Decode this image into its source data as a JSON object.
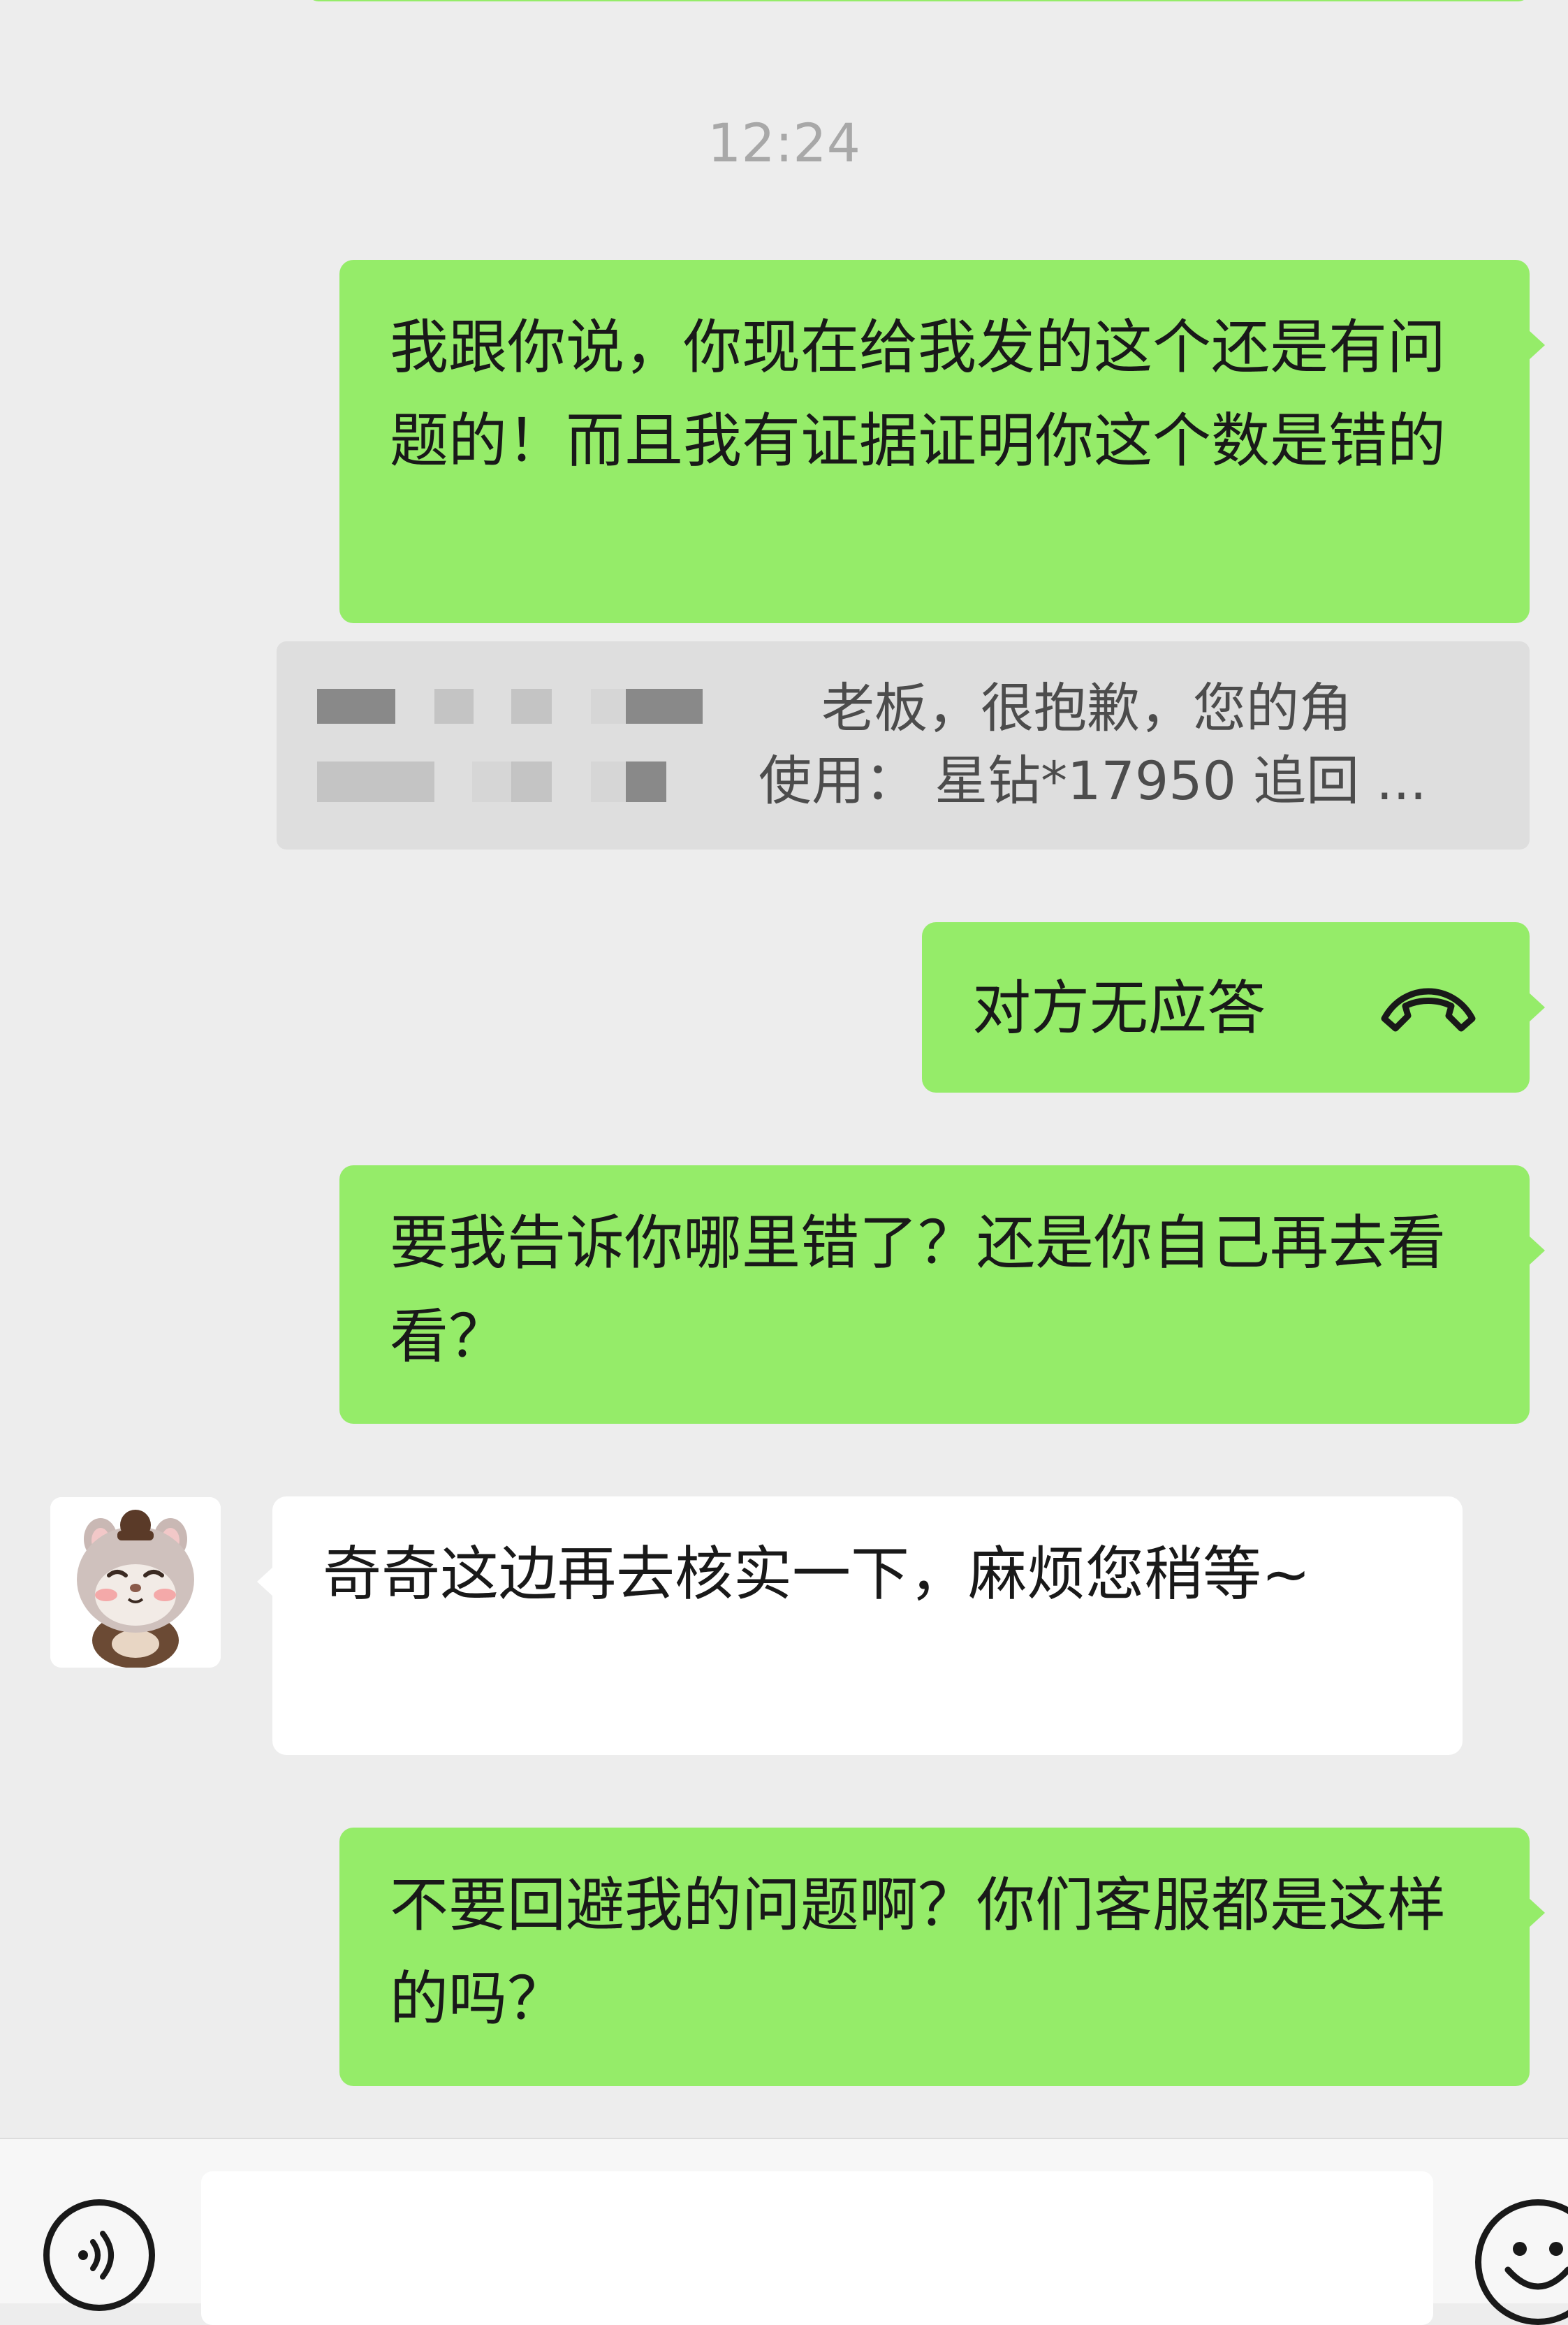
{
  "chat": {
    "timestamp": "12:24",
    "messages": [
      {
        "side": "sent",
        "type": "text",
        "text": "我跟你说，你现在给我发的这个还是有问题的！而且我有证据证明你这个数是错的"
      },
      {
        "side": "quote",
        "type": "quote",
        "line1": "老板，很抱歉，您的角",
        "line2": "使用： 星钻*17950 追回 ..."
      },
      {
        "side": "sent",
        "type": "call",
        "text": "对方无应答",
        "icon": "hangup-phone-icon"
      },
      {
        "side": "sent",
        "type": "text",
        "text": "要我告诉你哪里错了？还是你自己再去看看？"
      },
      {
        "side": "received",
        "type": "text",
        "text": "奇奇这边再去核实一下，麻烦您稍等~",
        "avatar": "hamster-avatar"
      },
      {
        "side": "sent",
        "type": "text",
        "text": "不要回避我的问题啊？你们客服都是这样的吗？"
      }
    ]
  },
  "input_bar": {
    "voice_icon": "voice-input-icon",
    "text_value": "",
    "emoji_icon": "emoji-icon"
  },
  "colors": {
    "sent_bubble": "#95ec69",
    "received_bubble": "#ffffff",
    "background": "#ededed",
    "timestamp": "#a8a8a8"
  }
}
